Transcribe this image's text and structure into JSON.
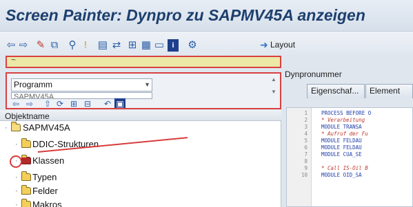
{
  "window": {
    "title": "Screen Painter: Dynpro zu SAPMV45A anzeigen"
  },
  "toolbar": {
    "icons": [
      "back-icon",
      "forward-icon",
      "display-change-icon",
      "other-object-icon",
      "where-used-icon",
      "check-icon",
      "activate-icon",
      "object-list-icon",
      "structure-icon",
      "test-icon",
      "info-icon",
      "settings-icon"
    ],
    "layout_label": "Layout"
  },
  "command_field": {
    "value": "~"
  },
  "navigation": {
    "object_type_select": "Programm",
    "object_name_partial": "SAPMV45A"
  },
  "tree": {
    "header": "Objektname",
    "root": "SAPMV45A",
    "nodes": [
      {
        "label": "DDIC-Strukturen"
      },
      {
        "label": "Klassen"
      },
      {
        "label": "Typen"
      },
      {
        "label": "Felder"
      },
      {
        "label": "Makros"
      }
    ]
  },
  "right_panel": {
    "dynpro_label": "Dynpronummer",
    "tabs": [
      "Eigenschaf...",
      "Element"
    ]
  },
  "editor": {
    "lines": [
      {
        "num": "1",
        "text": "PROCESS BEFORE O",
        "kind": "kw"
      },
      {
        "num": "2",
        "text": "* Verarbeitung",
        "kind": "cm"
      },
      {
        "num": "3",
        "text": "MODULE TRANSA",
        "kind": "kw"
      },
      {
        "num": "4",
        "text": "* Aufruf der Fu",
        "kind": "cm"
      },
      {
        "num": "5",
        "text": "MODULE FELDAU",
        "kind": "kw"
      },
      {
        "num": "6",
        "text": "MODULE FELDAU",
        "kind": "kw"
      },
      {
        "num": "7",
        "text": "MODULE CUA_SE",
        "kind": "kw"
      },
      {
        "num": "8",
        "text": "",
        "kind": "kw"
      },
      {
        "num": "9",
        "text": "* Call IS-Oil B",
        "kind": "cm"
      },
      {
        "num": "10",
        "text": "MODULE OID_SA",
        "kind": "kw"
      }
    ]
  },
  "colors": {
    "title_text": "#1d3f6e",
    "annotation_red": "#d83a3a",
    "command_field_bg": "#ece9a6",
    "folder_yellow": "#f3cf5a"
  }
}
